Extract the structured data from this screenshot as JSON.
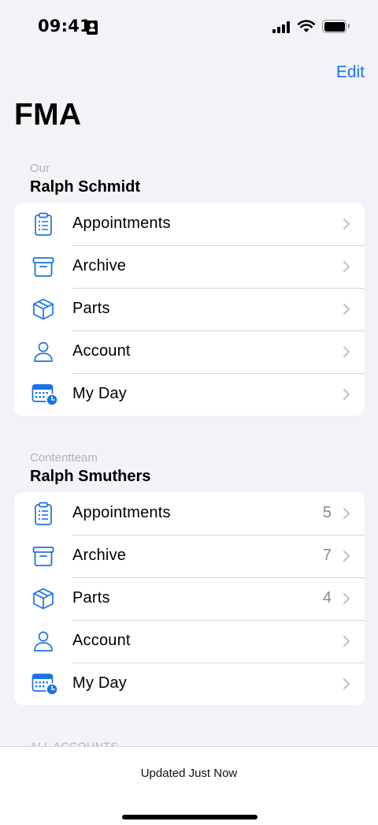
{
  "status_bar": {
    "time": "09:41"
  },
  "header": {
    "edit_label": "Edit",
    "title": "FMA"
  },
  "accounts": [
    {
      "caption": "Our",
      "name": "Ralph Schmidt",
      "rows": [
        {
          "icon": "clipboard-list-icon",
          "label": "Appointments",
          "count": ""
        },
        {
          "icon": "archive-box-icon",
          "label": "Archive",
          "count": ""
        },
        {
          "icon": "package-cube-icon",
          "label": "Parts",
          "count": ""
        },
        {
          "icon": "person-icon",
          "label": "Account",
          "count": ""
        },
        {
          "icon": "calendar-clock-icon",
          "label": "My Day",
          "count": ""
        }
      ]
    },
    {
      "caption": "Contentteam",
      "name": "Ralph Smuthers",
      "rows": [
        {
          "icon": "clipboard-list-icon",
          "label": "Appointments",
          "count": "5"
        },
        {
          "icon": "archive-box-icon",
          "label": "Archive",
          "count": "7"
        },
        {
          "icon": "package-cube-icon",
          "label": "Parts",
          "count": "4"
        },
        {
          "icon": "person-icon",
          "label": "Account",
          "count": ""
        },
        {
          "icon": "calendar-clock-icon",
          "label": "My Day",
          "count": ""
        }
      ]
    }
  ],
  "all_accounts_label": "ALL ACCOUNTS",
  "toolbar": {
    "status": "Updated Just Now"
  },
  "colors": {
    "accent": "#1a73e8",
    "background": "#f2f2f7",
    "chevron": "#c4c4c7"
  }
}
